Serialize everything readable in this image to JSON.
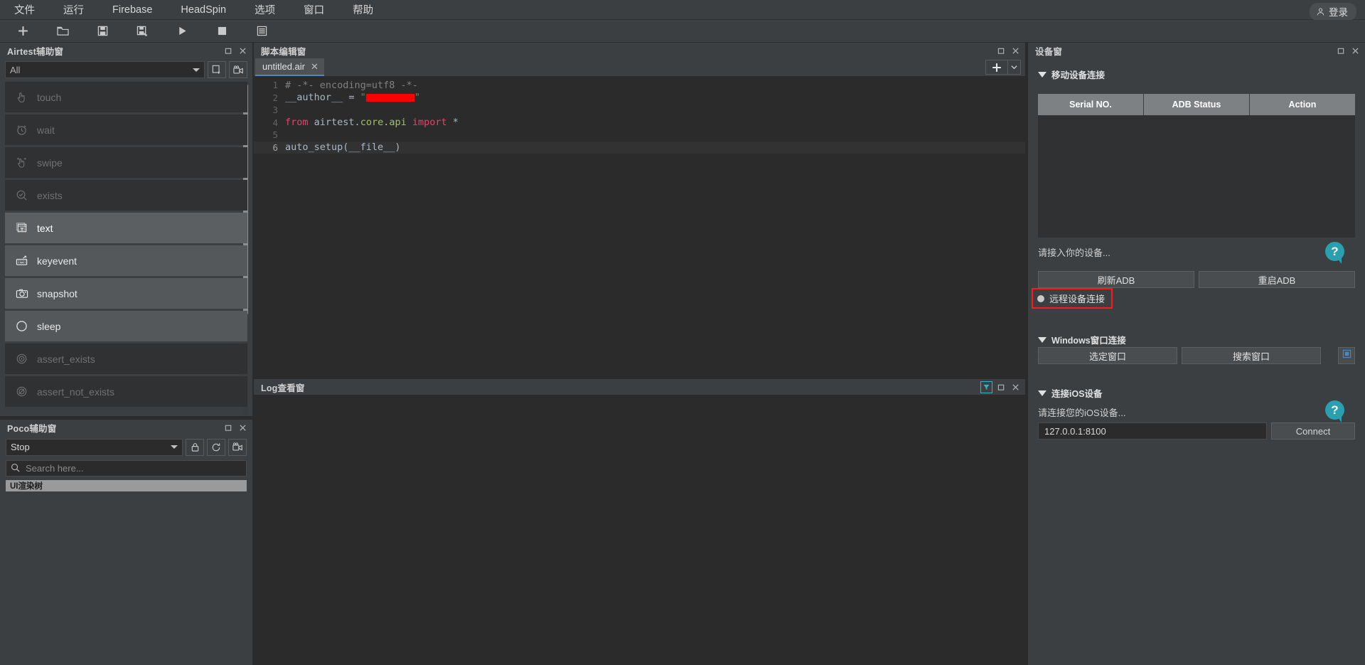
{
  "menubar": {
    "items": [
      {
        "label": "文件",
        "name": "menu-file"
      },
      {
        "label": "运行",
        "name": "menu-run"
      },
      {
        "label": "Firebase",
        "name": "menu-firebase"
      },
      {
        "label": "HeadSpin",
        "name": "menu-headspin"
      },
      {
        "label": "选项",
        "name": "menu-options"
      },
      {
        "label": "窗口",
        "name": "menu-window"
      },
      {
        "label": "帮助",
        "name": "menu-help"
      }
    ],
    "login_label": "登录"
  },
  "toolbar": {
    "buttons": [
      {
        "icon": "new-file-icon",
        "label": "新建"
      },
      {
        "icon": "open-folder-icon",
        "label": "打开"
      },
      {
        "icon": "save-icon",
        "label": "保存"
      },
      {
        "icon": "save-as-icon",
        "label": "另存为"
      },
      {
        "icon": "run-icon",
        "label": "运行"
      },
      {
        "icon": "stop-icon",
        "label": "停止"
      },
      {
        "icon": "report-icon",
        "label": "报告"
      }
    ]
  },
  "airtest_panel": {
    "title": "Airtest辅助窗",
    "filter_value": "All",
    "actions": [
      {
        "label": "touch",
        "icon": "hand-touch-icon",
        "state": "dim"
      },
      {
        "label": "wait",
        "icon": "clock-wait-icon",
        "state": "dim"
      },
      {
        "label": "swipe",
        "icon": "hand-swipe-icon",
        "state": "dim"
      },
      {
        "label": "exists",
        "icon": "magnifier-check-icon",
        "state": "dim"
      },
      {
        "label": "text",
        "icon": "text-box-icon",
        "state": "sel"
      },
      {
        "label": "keyevent",
        "icon": "keyboard-icon",
        "state": "lit"
      },
      {
        "label": "snapshot",
        "icon": "camera-icon",
        "state": "lit"
      },
      {
        "label": "sleep",
        "icon": "moon-icon",
        "state": "lit"
      },
      {
        "label": "assert_exists",
        "icon": "target-icon",
        "state": "dim"
      },
      {
        "label": "assert_not_exists",
        "icon": "target-off-icon",
        "state": "dim"
      }
    ]
  },
  "poco_panel": {
    "title": "Poco辅助窗",
    "mode_value": "Stop",
    "search_placeholder": "Search here...",
    "tree_header": "UI渲染树"
  },
  "editor_panel": {
    "title": "脚本编辑窗",
    "tab_name": "untitled.air",
    "tab_close": "✕",
    "code_lines": [
      {
        "no": "1",
        "tokens": [
          {
            "t": "# -*- encoding=utf8 -*-",
            "c": "c-com"
          }
        ]
      },
      {
        "no": "2",
        "tokens": [
          {
            "t": "__author__ = ",
            "c": "c-id"
          },
          {
            "t": "\"",
            "c": "c-str"
          },
          {
            "t": "REDACT",
            "c": "redact"
          },
          {
            "t": "\"",
            "c": "c-str"
          }
        ]
      },
      {
        "no": "3",
        "tokens": []
      },
      {
        "no": "4",
        "tokens": [
          {
            "t": "from ",
            "c": "c-kwp"
          },
          {
            "t": "airtest",
            "c": "c-id"
          },
          {
            "t": ".",
            "c": "c-id"
          },
          {
            "t": "core",
            "c": "c-mod"
          },
          {
            "t": ".",
            "c": "c-id"
          },
          {
            "t": "api ",
            "c": "c-mod"
          },
          {
            "t": "import ",
            "c": "c-kwp"
          },
          {
            "t": "*",
            "c": "c-id"
          }
        ]
      },
      {
        "no": "5",
        "tokens": []
      },
      {
        "no": "6",
        "tokens": [
          {
            "t": "auto_setup(__file__)",
            "c": "c-fn"
          }
        ],
        "current": true
      }
    ]
  },
  "log_panel": {
    "title": "Log查看窗"
  },
  "device_panel": {
    "title": "设备窗",
    "mobile_section": "移动设备连接",
    "table_headers": [
      "Serial NO.",
      "ADB Status",
      "Action"
    ],
    "mobile_hint": "请接入你的设备...",
    "refresh_adb": "刷新ADB",
    "restart_adb": "重启ADB",
    "remote_device": "远程设备连接",
    "windows_section": "Windows窗口连接",
    "select_window": "选定窗口",
    "search_window": "搜索窗口",
    "ios_section": "连接iOS设备",
    "ios_hint": "请连接您的iOS设备...",
    "ios_address": "127.0.0.1:8100",
    "ios_connect": "Connect",
    "help_glyph": "?"
  },
  "colors": {
    "panel_bg": "#3c3f41",
    "editor_bg": "#2b2b2b",
    "accent_blue": "#4a88c7",
    "highlight_red": "#ff1a1a",
    "help_teal": "#2a9fb0"
  }
}
